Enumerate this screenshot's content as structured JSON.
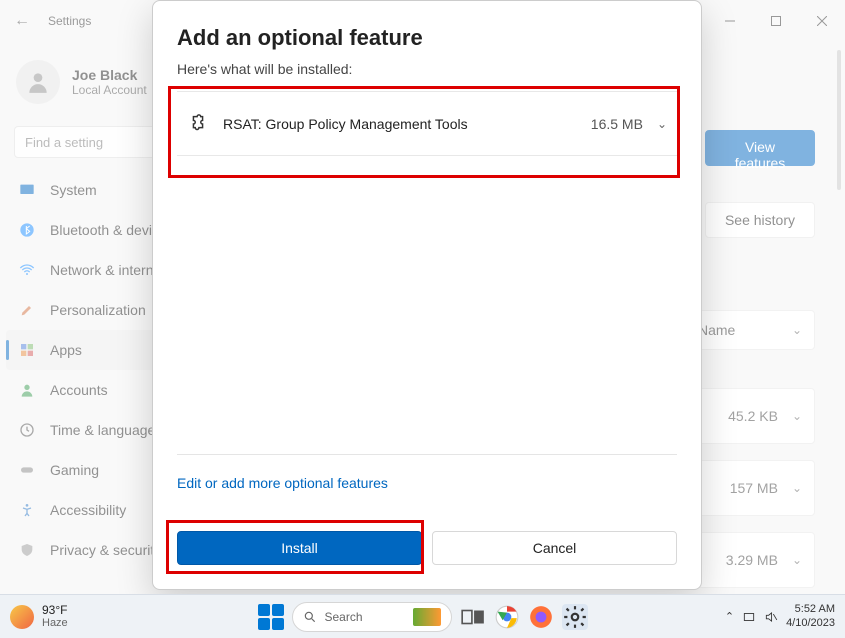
{
  "window": {
    "title": "Settings"
  },
  "profile": {
    "name": "Joe Black",
    "account_type": "Local Account"
  },
  "search": {
    "placeholder": "Find a setting"
  },
  "sidebar": {
    "items": [
      {
        "label": "System"
      },
      {
        "label": "Bluetooth & devices"
      },
      {
        "label": "Network & internet"
      },
      {
        "label": "Personalization"
      },
      {
        "label": "Apps"
      },
      {
        "label": "Accounts"
      },
      {
        "label": "Time & language"
      },
      {
        "label": "Gaming"
      },
      {
        "label": "Accessibility"
      },
      {
        "label": "Privacy & security"
      }
    ]
  },
  "content": {
    "view_features_label": "View features",
    "see_history_label": "See history",
    "sort_label": "Name",
    "rows": [
      {
        "size": "45.2 KB"
      },
      {
        "size": "157 MB"
      },
      {
        "size": "3.29 MB"
      }
    ]
  },
  "dialog": {
    "title": "Add an optional feature",
    "subtitle": "Here's what will be installed:",
    "features": [
      {
        "name": "RSAT: Group Policy Management Tools",
        "size": "16.5 MB"
      }
    ],
    "edit_link": "Edit or add more optional features",
    "install_label": "Install",
    "cancel_label": "Cancel"
  },
  "taskbar": {
    "weather_temp": "93°F",
    "weather_cond": "Haze",
    "search_placeholder": "Search",
    "time": "5:52 AM",
    "date": "4/10/2023"
  }
}
